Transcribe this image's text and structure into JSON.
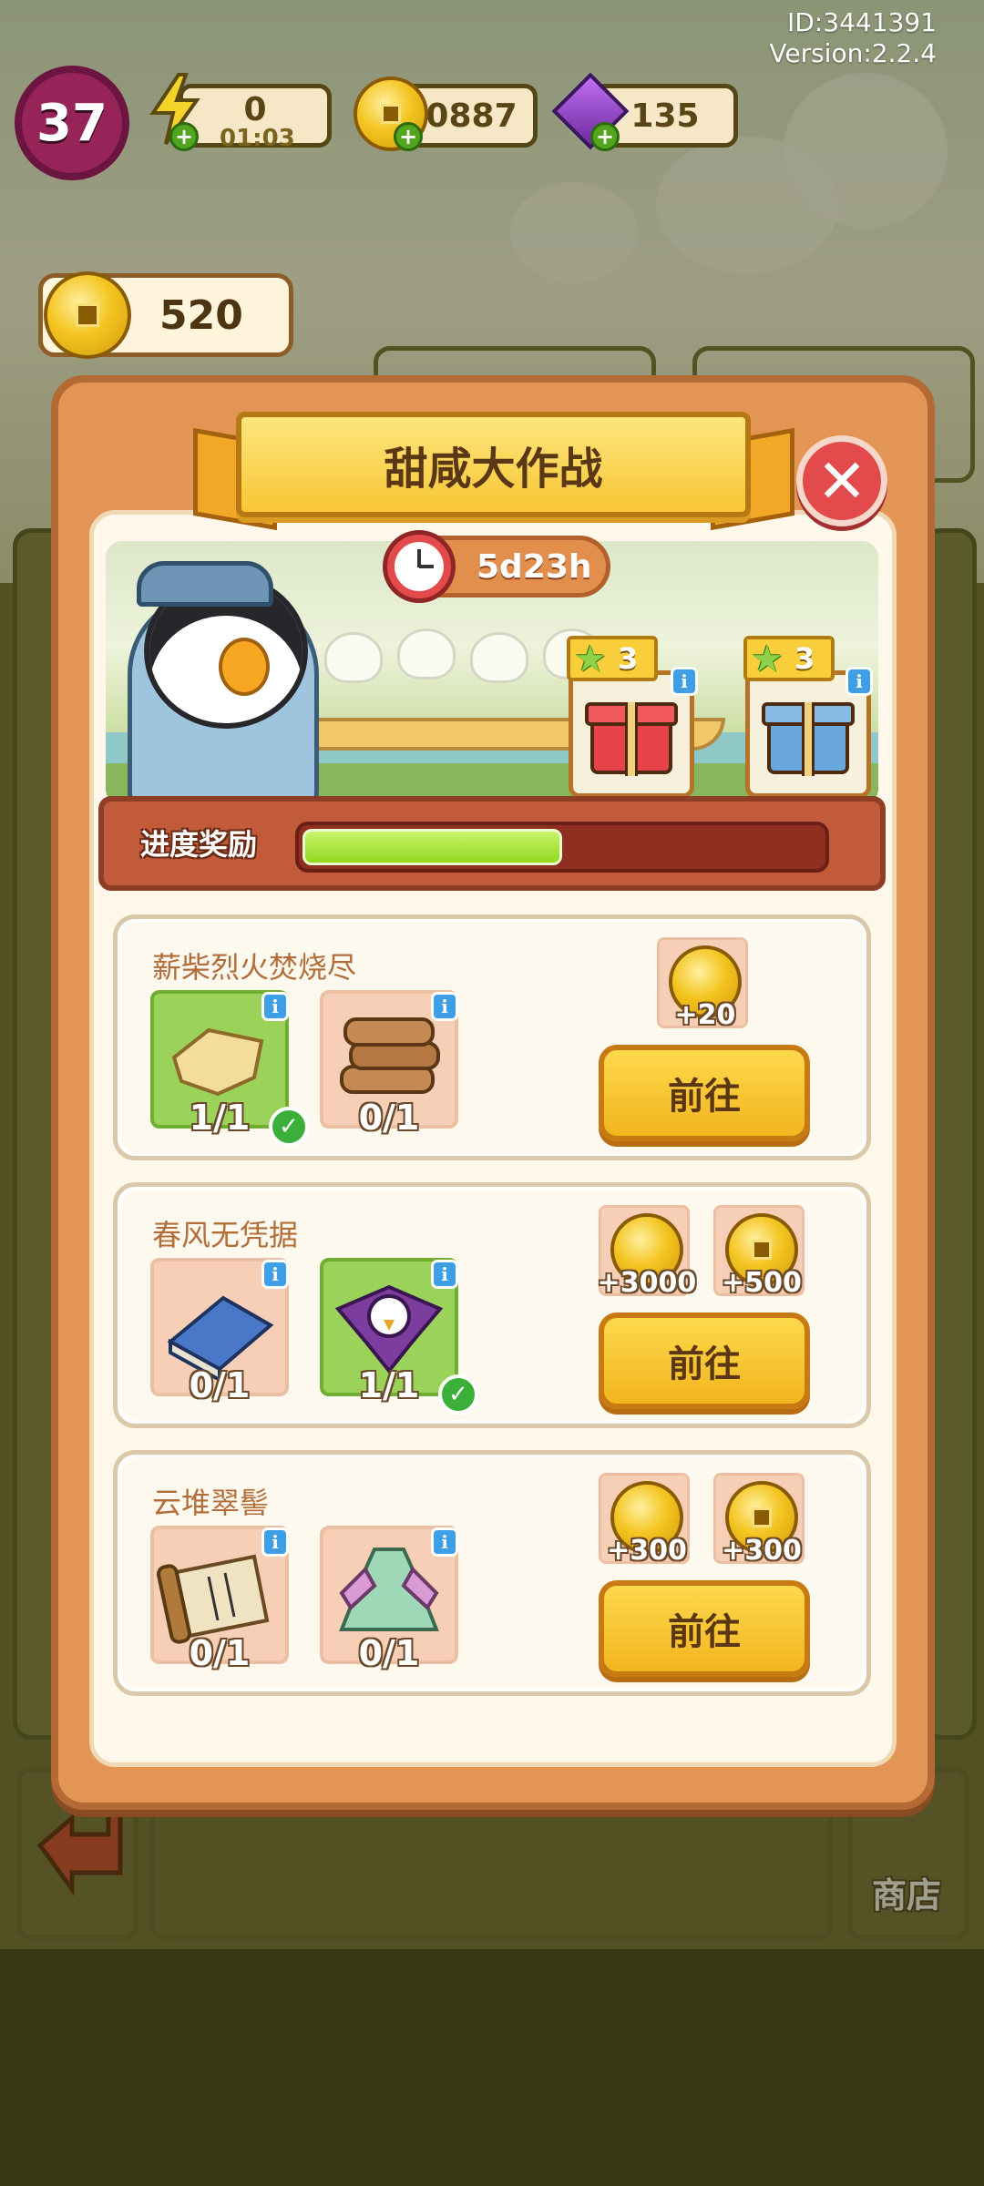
{
  "header": {
    "id_line": "ID:3441391",
    "version_line": "Version:2.2.4",
    "level": "37",
    "energy": {
      "value": "0",
      "timer": "01:03"
    },
    "coins": "30887",
    "gems": "135",
    "plus_symbol": "+"
  },
  "event_coin_balance": "520",
  "modal": {
    "title": "甜咸大作战",
    "timer": "5d23h",
    "progress_label": "进度奖励",
    "progress_fraction": 0.5,
    "gift_rewards": [
      {
        "stars": "3",
        "color": "red"
      },
      {
        "stars": "3",
        "color": "blue"
      }
    ],
    "info_symbol": "i",
    "check_symbol": "✓",
    "tasks": [
      {
        "title": "薪柴烈火焚烧尽",
        "items": [
          {
            "icon": "paper-scrap-icon",
            "count": "1/1",
            "done": true
          },
          {
            "icon": "firewood-icon",
            "count": "0/1",
            "done": false
          }
        ],
        "rewards": [
          {
            "icon": "gold-coin-icon",
            "amount": "+20"
          }
        ],
        "button": "前往"
      },
      {
        "title": "春风无凭据",
        "items": [
          {
            "icon": "blue-book-icon",
            "count": "0/1",
            "done": false
          },
          {
            "icon": "bird-kite-icon",
            "count": "1/1",
            "done": true
          }
        ],
        "rewards": [
          {
            "icon": "gold-coin-icon",
            "amount": "+3000"
          },
          {
            "icon": "event-coin-icon",
            "amount": "+500"
          }
        ],
        "button": "前往"
      },
      {
        "title": "云堆翠髻",
        "items": [
          {
            "icon": "scroll-icon",
            "count": "0/1",
            "done": false
          },
          {
            "icon": "hanfu-dress-icon",
            "count": "0/1",
            "done": false
          }
        ],
        "rewards": [
          {
            "icon": "gold-coin-icon",
            "amount": "+300"
          },
          {
            "icon": "event-coin-icon",
            "amount": "+300"
          }
        ],
        "button": "前往"
      }
    ]
  },
  "bottom_bar": {
    "shop_label": "商店"
  },
  "colors": {
    "accent": "#f7c634",
    "progress_fill": "#93d81f",
    "close_button": "#e34a4b",
    "modal_frame": "#e29555"
  }
}
